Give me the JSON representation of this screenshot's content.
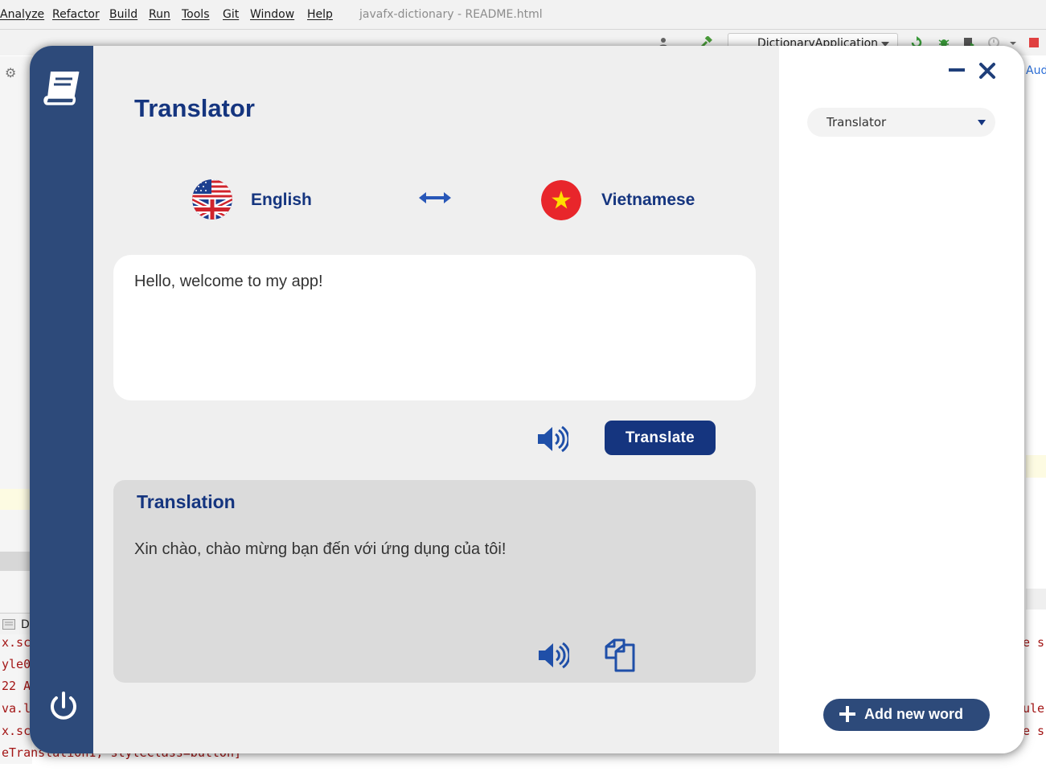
{
  "ide": {
    "menu": [
      "Analyze",
      "Refactor",
      "Build",
      "Run",
      "Tools",
      "Git",
      "Window",
      "Help"
    ],
    "title": "javafx-dictionary - README.html",
    "run_config": "DictionaryApplication",
    "right_tab": "Aud",
    "console_lines": [
      "x.sc",
      "yle0",
      "22 A",
      "va.l",
      "x.sc",
      "eTranslation1, styleClass=button]"
    ],
    "console_head": "D",
    "console_right": [
      "e s",
      "ule",
      "e s"
    ]
  },
  "app": {
    "colors": {
      "primary": "#15357f",
      "sidebar": "#2d4a7a",
      "panel": "#efefef",
      "output_bg": "#dbdbdb"
    },
    "sidebar": {
      "logo_icon": "book-icon",
      "power_icon": "power-icon"
    },
    "page_title": "Translator",
    "source_lang": {
      "label": "English",
      "flag": "uk-flag-icon"
    },
    "target_lang": {
      "label": "Vietnamese",
      "flag": "vietnam-flag-icon"
    },
    "swap_icon": "swap-arrows-icon",
    "input_text": "Hello, welcome to my app!",
    "translate_label": "Translate",
    "output_title": "Translation",
    "output_text": "Xin chào, chào mừng bạn đến với ứng dụng của tôi!",
    "mode_dropdown": {
      "value": "Translator"
    },
    "add_word_label": "Add new word"
  }
}
